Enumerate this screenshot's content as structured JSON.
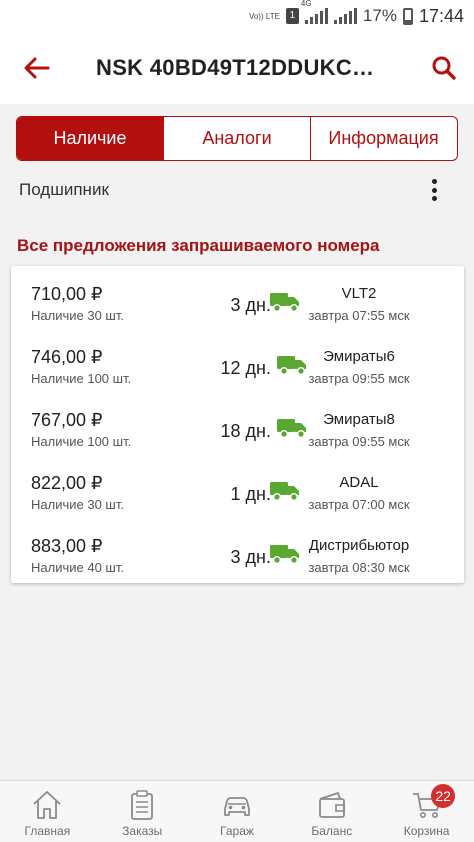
{
  "status_bar": {
    "volte": "Vo)) LTE",
    "sim": "1",
    "network": "4G",
    "battery_percent": "17%",
    "time": "17:44"
  },
  "app_bar": {
    "back_icon": "arrow-left-icon",
    "title": "NSK 40BD49T12DDUKC…",
    "search_icon": "search-icon"
  },
  "tabs": [
    {
      "label": "Наличие",
      "active": true
    },
    {
      "label": "Аналоги",
      "active": false
    },
    {
      "label": "Информация",
      "active": false
    }
  ],
  "subtitle": "Подшипник",
  "section_title": "Все предложения запрашиваемого номера",
  "offers": [
    {
      "price": "710,00 ₽",
      "stock": "Наличие 30 шт.",
      "days": "3 дн.",
      "supplier": "VLT2",
      "eta": "завтра 07:55 мск"
    },
    {
      "price": "746,00 ₽",
      "stock": "Наличие 100 шт.",
      "days": "12 дн.",
      "supplier": "Эмираты6",
      "eta": "завтра 09:55 мск"
    },
    {
      "price": "767,00 ₽",
      "stock": "Наличие 100 шт.",
      "days": "18 дн.",
      "supplier": "Эмираты8",
      "eta": "завтра 09:55 мск"
    },
    {
      "price": "822,00 ₽",
      "stock": "Наличие 30 шт.",
      "days": "1 дн.",
      "supplier": "ADAL",
      "eta": "завтра 07:00 мск"
    },
    {
      "price": "883,00 ₽",
      "stock": "Наличие 40 шт.",
      "days": "3 дн.",
      "supplier": "Дистрибьютор",
      "eta": "завтра 08:30 мск"
    }
  ],
  "bottom_nav": [
    {
      "label": "Главная",
      "icon": "home-icon"
    },
    {
      "label": "Заказы",
      "icon": "orders-icon"
    },
    {
      "label": "Гараж",
      "icon": "car-icon"
    },
    {
      "label": "Баланс",
      "icon": "wallet-icon"
    },
    {
      "label": "Корзина",
      "icon": "cart-icon",
      "badge": "22"
    }
  ],
  "colors": {
    "accent": "#b30f0f",
    "truck_green": "#5aa832",
    "badge_red": "#d32f2f"
  }
}
